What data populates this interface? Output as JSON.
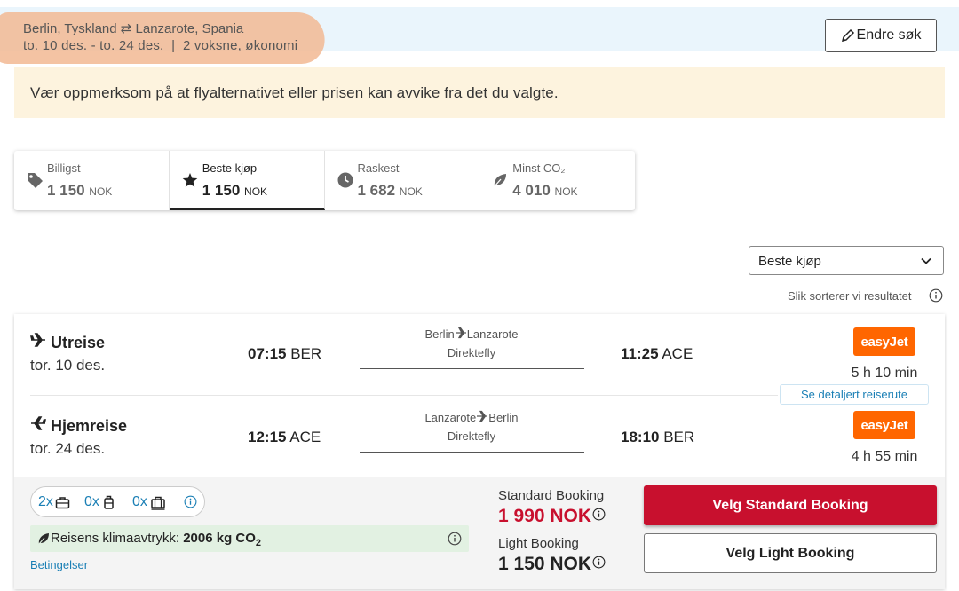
{
  "header": {
    "route": "Berlin, Tyskland ⇄ Lanzarote, Spania",
    "details": "to. 10 des. - to. 24 des.  |  2 voksne, økonomi",
    "edit_button": "Endre søk"
  },
  "notice": "Vær oppmerksom på at flyalternativet eller prisen kan avvike fra det du valgte.",
  "sort_tabs": [
    {
      "label": "Billigst",
      "price": "1 150",
      "currency": "NOK",
      "icon": "tag-icon"
    },
    {
      "label": "Beste kjøp",
      "price": "1 150",
      "currency": "NOK",
      "icon": "star-icon",
      "active": true
    },
    {
      "label": "Raskest",
      "price": "1 682",
      "currency": "NOK",
      "icon": "clock-icon"
    },
    {
      "label": "Minst CO₂",
      "price": "4 010",
      "currency": "NOK",
      "icon": "leaf-icon"
    }
  ],
  "sort": {
    "selected": "Beste kjøp",
    "info_text": "Slik sorterer vi resultatet"
  },
  "result": {
    "outbound": {
      "direction": "Utreise",
      "date": "tor. 10 des.",
      "dep_time": "07:15",
      "dep_airport": "BER",
      "from_city": "Berlin",
      "to_city": "Lanzarote",
      "stops": "Direktefly",
      "arr_time": "11:25",
      "arr_airport": "ACE",
      "airline": "easyJet",
      "duration": "5 h 10 min"
    },
    "details_link": "Se detaljert reiserute",
    "return": {
      "direction": "Hjemreise",
      "date": "tor. 24 des.",
      "dep_time": "12:15",
      "dep_airport": "ACE",
      "from_city": "Lanzarote",
      "to_city": "Berlin",
      "stops": "Direktefly",
      "arr_time": "18:10",
      "arr_airport": "BER",
      "airline": "easyJet",
      "duration": "4 h 55 min"
    },
    "baggage": {
      "personal_item": "2x",
      "cabin_bag": "0x",
      "checked_bag": "0x"
    },
    "climate_label": "Reisens klimaavtrykk: ",
    "climate_value": "2006 kg CO",
    "climate_sub": "2",
    "terms": "Betingelser",
    "standard": {
      "label": "Standard Booking",
      "price": "1 990 NOK",
      "button": "Velg Standard Booking"
    },
    "light": {
      "label": "Light Booking",
      "price": "1 150 NOK",
      "button": "Velg Light Booking"
    }
  },
  "colors": {
    "accent_red": "#c8102e",
    "link_blue": "#1a7fb5",
    "airline_orange": "#ff6600",
    "notice_bg": "#fdf3de",
    "climate_bg": "#e2f1e2"
  }
}
